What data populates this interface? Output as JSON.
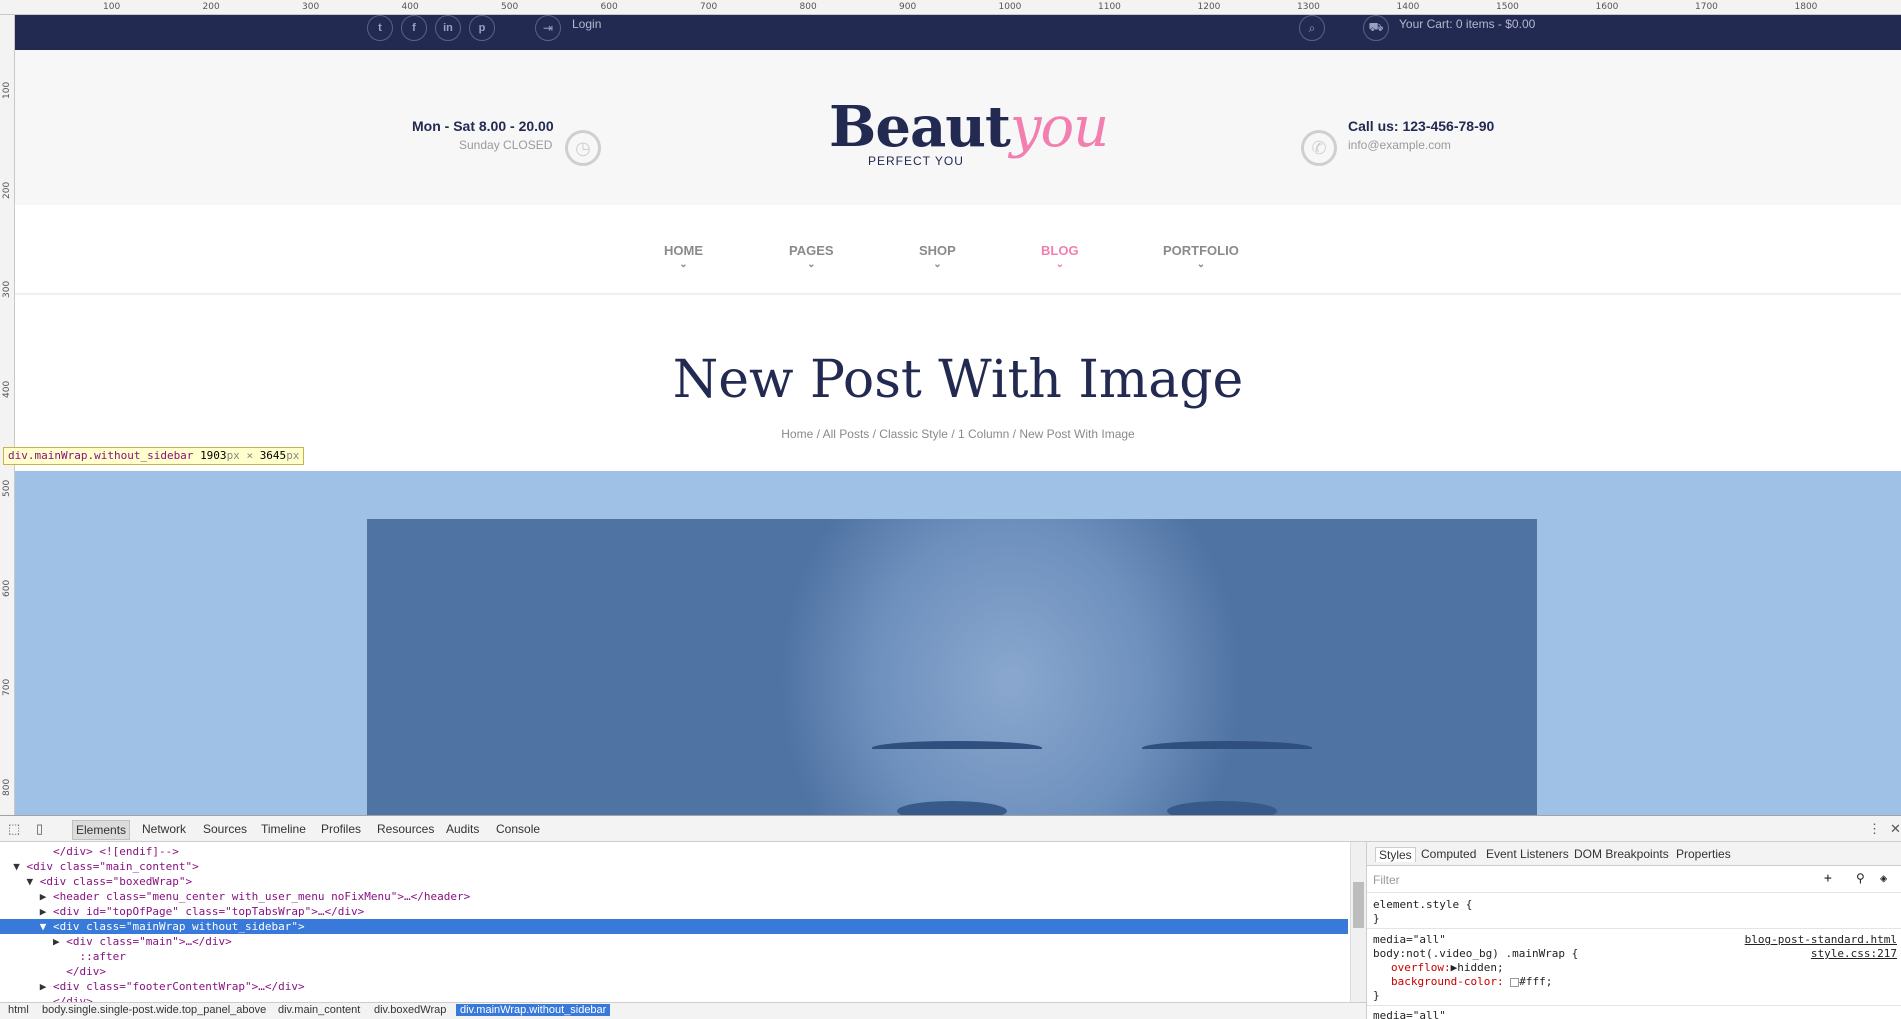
{
  "rulers": {
    "top": [
      "100",
      "200",
      "300",
      "400",
      "500",
      "600",
      "700",
      "800",
      "900",
      "1000",
      "1100",
      "1200",
      "1300",
      "1400",
      "1500",
      "1600",
      "1700",
      "1800"
    ],
    "left": [
      "100",
      "200",
      "300",
      "400",
      "500",
      "600",
      "700",
      "800"
    ]
  },
  "topbar": {
    "social": [
      "twitter",
      "facebook",
      "linkedin",
      "pinterest"
    ],
    "social_glyphs": [
      "t",
      "f",
      "in",
      "p"
    ],
    "login_label": "Login",
    "cart_label": "Your Cart: 0 items - $0.00"
  },
  "header": {
    "hours_main": "Mon - Sat 8.00 - 20.00",
    "hours_sub": "Sunday CLOSED",
    "logo_main": "Beaut",
    "logo_accent": "you",
    "logo_tagline": "PERFECT YOU",
    "call_main": "Call us: 123-456-78-90",
    "call_sub": "info@example.com"
  },
  "nav": {
    "items": [
      {
        "label": "HOME",
        "active": false
      },
      {
        "label": "PAGES",
        "active": false
      },
      {
        "label": "SHOP",
        "active": false
      },
      {
        "label": "BLOG",
        "active": true
      },
      {
        "label": "PORTFOLIO",
        "active": false
      }
    ]
  },
  "post": {
    "title": "New Post With Image",
    "breadcrumbs": "Home / All Posts / Classic Style / 1 Column / New Post With Image"
  },
  "tooltip": {
    "element": "div.mainWrap.without_sidebar",
    "width": "1903",
    "height": "3645",
    "unit": "px",
    "times": "×"
  },
  "devtools": {
    "tabs": [
      "Elements",
      "Network",
      "Sources",
      "Timeline",
      "Profiles",
      "Resources",
      "Audits",
      "Console"
    ],
    "active_tab": "Elements",
    "dom_lines": [
      {
        "indent": "      ",
        "arrow": "",
        "text": "</div>  <![endif]-->"
      },
      {
        "indent": "  ",
        "arrow": "▼",
        "text": "<div class=\"main_content\">"
      },
      {
        "indent": "    ",
        "arrow": "▼",
        "text": "<div class=\"boxedWrap\">"
      },
      {
        "indent": "      ",
        "arrow": "▶",
        "text": "<header class=\"menu_center with_user_menu noFixMenu\">…</header>"
      },
      {
        "indent": "      ",
        "arrow": "▶",
        "text": "<div id=\"topOfPage\" class=\"topTabsWrap\">…</div>"
      },
      {
        "indent": "      ",
        "arrow": "▼",
        "text": "<div class=\"mainWrap without_sidebar\">"
      },
      {
        "indent": "        ",
        "arrow": "▶",
        "text": "<div class=\"main\">…</div>"
      },
      {
        "indent": "          ",
        "arrow": "",
        "text": "::after"
      },
      {
        "indent": "        ",
        "arrow": "",
        "text": "</div>"
      },
      {
        "indent": "      ",
        "arrow": "▶",
        "text": "<div class=\"footerContentWrap\">…</div>"
      },
      {
        "indent": "      ",
        "arrow": "",
        "text": "</div>"
      }
    ],
    "selected_line": 5,
    "breadcrumbs": [
      "html",
      "body.single.single-post.wide.top_panel_above",
      "div.main_content",
      "div.boxedWrap",
      "div.mainWrap.without_sidebar"
    ],
    "styles_tabs": [
      "Styles",
      "Computed",
      "Event Listeners",
      "DOM Breakpoints",
      "Properties"
    ],
    "filter_placeholder": "Filter",
    "element_style_open": "element.style {",
    "element_style_close": "}",
    "media_line": "media=\"all\"",
    "selector_line": "body:not(.video_bg) .mainWrap {",
    "prop1_name": "overflow:",
    "prop1_value": "▶hidden;",
    "prop2_name": "background-color:",
    "prop2_value": "#fff;",
    "rule_close": "}",
    "source_file": "blog-post-standard.html",
    "source_css": "style.css:217",
    "more_line": "media=\"all\""
  }
}
